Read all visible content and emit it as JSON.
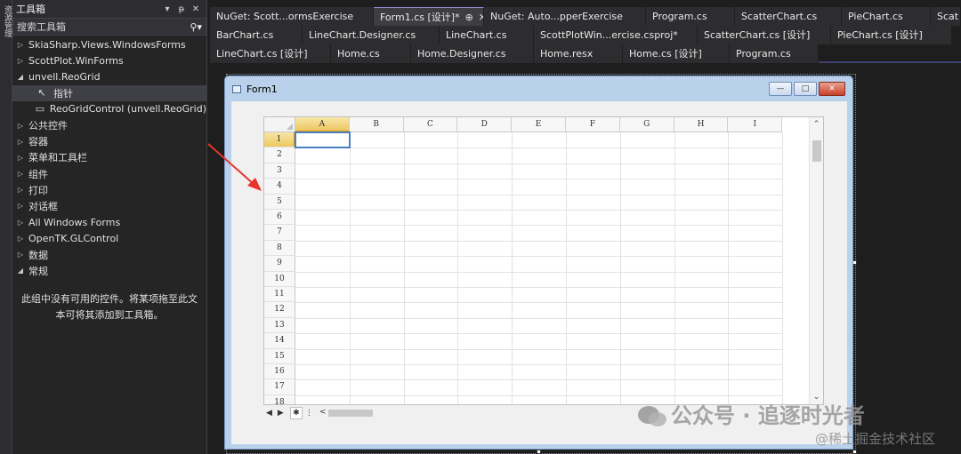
{
  "side_strip": {
    "label": "资源管理"
  },
  "toolbox": {
    "title": "工具箱",
    "search_placeholder": "搜索工具箱",
    "items": [
      {
        "label": "SkiaSharp.Views.WindowsForms",
        "arrow": "▷"
      },
      {
        "label": "ScottPlot.WinForms",
        "arrow": "▷"
      },
      {
        "label": "unvell.ReoGrid",
        "arrow": "◢"
      },
      {
        "label": "指针",
        "icon": "pointer-icon",
        "child": true,
        "selected": true
      },
      {
        "label": "ReoGridControl (unvell.ReoGrid)",
        "icon": "control-icon",
        "child": true
      },
      {
        "label": "公共控件",
        "arrow": "▷"
      },
      {
        "label": "容器",
        "arrow": "▷"
      },
      {
        "label": "菜单和工具栏",
        "arrow": "▷"
      },
      {
        "label": "组件",
        "arrow": "▷"
      },
      {
        "label": "打印",
        "arrow": "▷"
      },
      {
        "label": "对话框",
        "arrow": "▷"
      },
      {
        "label": "All Windows Forms",
        "arrow": "▷"
      },
      {
        "label": "OpenTK.GLControl",
        "arrow": "▷"
      },
      {
        "label": "数据",
        "arrow": "▷"
      },
      {
        "label": "常规",
        "arrow": "◢"
      }
    ],
    "empty_line1": "此组中没有可用的控件。将某项拖至此文",
    "empty_line2": "本可将其添加到工具箱。"
  },
  "tabs": {
    "row1": [
      "NuGet: Scott...ormsExercise",
      "Form1.cs [设计]*",
      "NuGet: Auto...pperExercise",
      "Program.cs",
      "ScatterChart.cs",
      "PieChart.cs",
      "Scat"
    ],
    "row2": [
      "BarChart.cs",
      "LineChart.Designer.cs",
      "LineChart.cs",
      "ScottPlotWin...ercise.csproj*",
      "ScatterChart.cs [设计]",
      "PieChart.cs [设计]"
    ],
    "row3": [
      "LineChart.cs [设计]",
      "Home.cs",
      "Home.Designer.cs",
      "Home.resx",
      "Home.cs [设计]",
      "Program.cs"
    ],
    "active_pin": "⊕",
    "active_close": "✕"
  },
  "form": {
    "title": "Form1",
    "minimize": "—",
    "maximize": "□",
    "close": "✕"
  },
  "grid": {
    "columns": [
      "A",
      "B",
      "C",
      "D",
      "E",
      "F",
      "G",
      "H",
      "I"
    ],
    "rows": [
      "1",
      "2",
      "3",
      "4",
      "5",
      "6",
      "7",
      "8",
      "9",
      "10",
      "11",
      "12",
      "13",
      "14",
      "15",
      "16",
      "17",
      "18"
    ],
    "selected_cell": "A1"
  },
  "sheetbar": {
    "prev": "◀",
    "next": "▶",
    "add": "✱",
    "menu": "⋮",
    "hscroll_left": "<"
  },
  "watermark": {
    "line1": "公众号 · 追逐时光者",
    "line2": "@稀土掘金技术社区"
  },
  "colors": {
    "accent": "#8f8fd6",
    "selection": "#4a7fc1",
    "header_selected": "#ecc760",
    "arrow": "#e8332a"
  }
}
